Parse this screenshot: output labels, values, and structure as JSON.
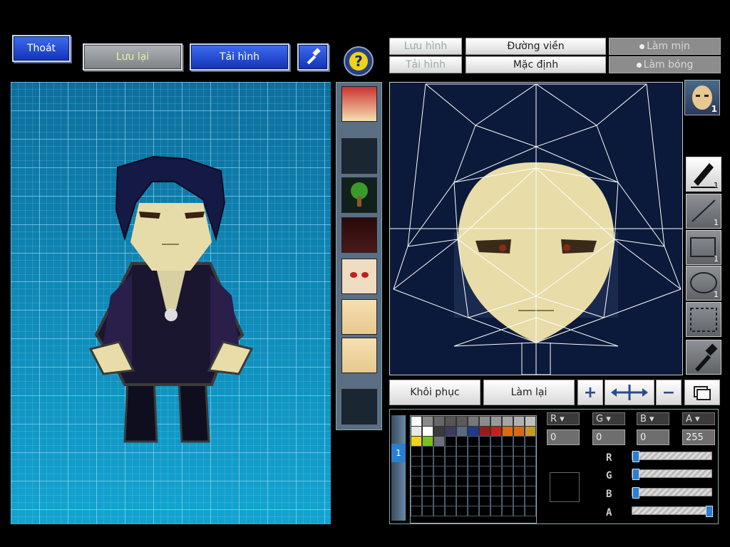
{
  "top_buttons": {
    "exit": "Thoát",
    "save": "Lưu lại",
    "load": "Tải hình",
    "help_icon": "question-icon",
    "tool_icon": "hammer-icon"
  },
  "editor_buttons": {
    "save_image": "Lưu hình",
    "load_image": "Tải hình",
    "outline": "Đường viền",
    "default": "Mặc định",
    "smooth": "Làm mịn",
    "shine": "Làm bóng"
  },
  "bottom_buttons": {
    "restore": "Khôi phục",
    "redo": "Làm lại",
    "zoom_in": "+",
    "move": "move-icon",
    "zoom_out": "−"
  },
  "tools": [
    {
      "name": "pen",
      "count": "1"
    },
    {
      "name": "line",
      "count": "1"
    },
    {
      "name": "rect",
      "count": "1"
    },
    {
      "name": "ellipse",
      "count": "1"
    },
    {
      "name": "select",
      "count": ""
    },
    {
      "name": "eyedropper",
      "count": ""
    }
  ],
  "face_badge": "1",
  "color_channels": {
    "labels": [
      "R",
      "G",
      "B",
      "A"
    ],
    "values": [
      "0",
      "0",
      "0",
      "255"
    ]
  },
  "slider_levels": {
    "R": 0,
    "G": 0,
    "B": 0,
    "A": 1
  },
  "layer_tab": "1",
  "palette_colors": [
    "#ffffff",
    "#8a8a8a",
    "#666666",
    "#555555",
    "#5a5a5a",
    "#777777",
    "#8c8c8c",
    "#999999",
    "#a4a4a4",
    "#b0b0b0",
    "#c0c0c0",
    "#e8e8e8",
    "#ffffff",
    "#3a3a3a",
    "#3c3c5c",
    "#5a6a80",
    "#1e3a8a",
    "#9a1a1a",
    "#c81e1e",
    "#e06a10",
    "#d86a10",
    "#c89a20",
    "#f2d21a",
    "#7ac21a",
    "#6e6e7e"
  ],
  "colors": {
    "preview_bg": "#0e86bb",
    "button_blue": "#2a52d8",
    "canvas_bg": "#0b1a3a",
    "slider_thumb": "#2a7fd0"
  }
}
